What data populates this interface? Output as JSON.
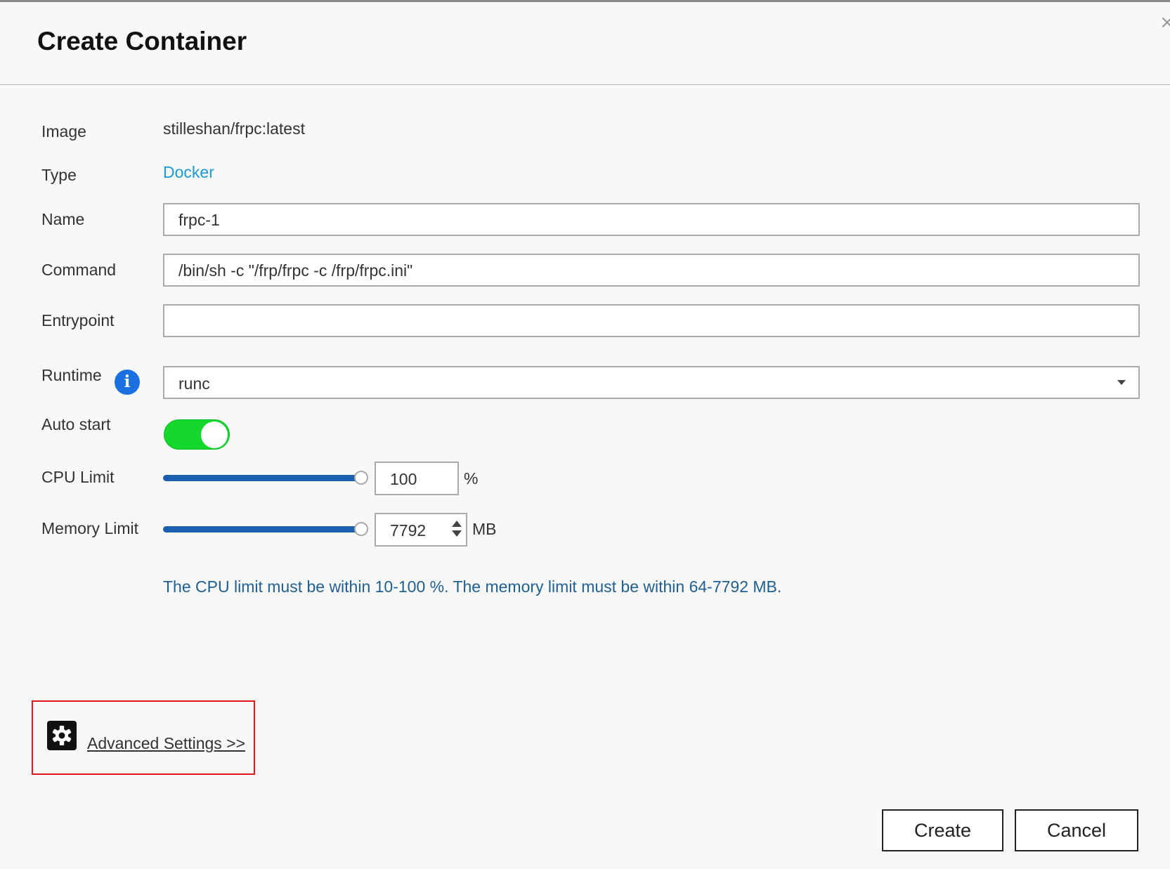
{
  "dialog": {
    "title": "Create Container",
    "close_label": "×"
  },
  "form": {
    "image": {
      "label": "Image",
      "value": "stilleshan/frpc:latest"
    },
    "type": {
      "label": "Type",
      "value": "Docker"
    },
    "name": {
      "label": "Name",
      "value": "frpc-1"
    },
    "command": {
      "label": "Command",
      "value": "/bin/sh -c \"/frp/frpc -c /frp/frpc.ini\""
    },
    "entrypoint": {
      "label": "Entrypoint",
      "value": ""
    },
    "runtime": {
      "label": "Runtime",
      "selected": "runc",
      "info_icon": "info-icon"
    },
    "auto_start": {
      "label": "Auto start",
      "enabled": true
    },
    "cpu_limit": {
      "label": "CPU Limit",
      "value": "100",
      "unit": "%",
      "slider_fraction": 1.0
    },
    "memory_limit": {
      "label": "Memory Limit",
      "value": "7792",
      "unit": "MB",
      "slider_fraction": 1.0
    },
    "hint": "The CPU limit must be within 10-100 %. The memory limit must be within 64-7792 MB."
  },
  "advanced": {
    "icon": "gear-icon",
    "label": "Advanced Settings >>"
  },
  "buttons": {
    "create": "Create",
    "cancel": "Cancel"
  },
  "colors": {
    "link": "#1a9ad6",
    "info_icon": "#1b6fe0",
    "toggle_on": "#14d82c",
    "slider": "#1b5fb0",
    "hint_text": "#1f5f93",
    "highlight_border": "#e0161c"
  }
}
